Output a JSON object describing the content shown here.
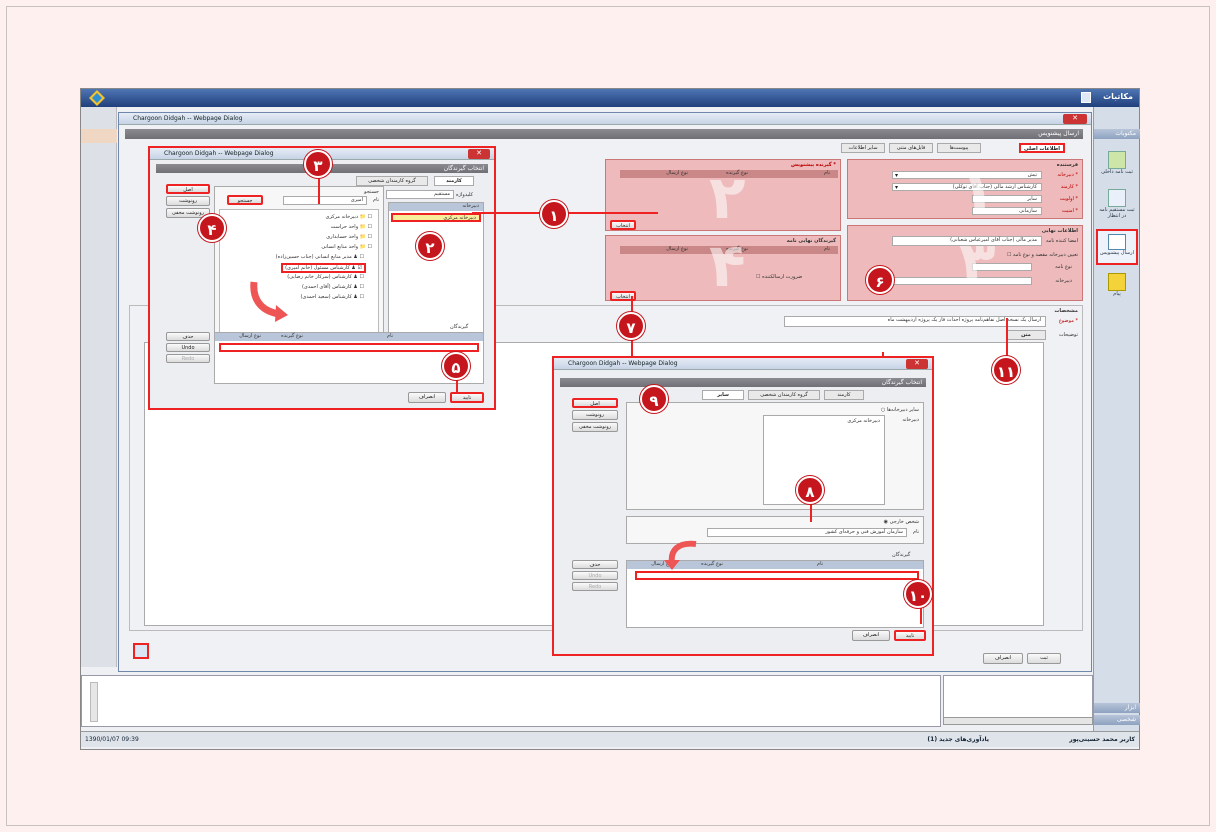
{
  "main_window": {
    "title": "مکاتبات",
    "sidebar_header": "مکتوبات",
    "sidebar_items": [
      {
        "label": "ثبت نامه داخلی",
        "icon": "new-letter-icon"
      },
      {
        "label": "ثبت مستقیم نامه در انتظار",
        "icon": "direct-letter-icon"
      },
      {
        "label": "ارسال پیشنویس",
        "icon": "send-draft-icon"
      },
      {
        "label": "پیام",
        "icon": "message-icon"
      }
    ],
    "sidebar_footer_tools": "ابزار",
    "sidebar_footer_personal": "شخصی",
    "status_user": "کاربر محمد حسینی‌پور",
    "status_reminders": "یادآوری‌های جدید (1)",
    "status_datetime": "1390/01/07 09:39"
  },
  "draft_dialog": {
    "title": "Chargoon Didgah -- Webpage Dialog",
    "header": "ارسال پیشنویس",
    "tabs": [
      "اطلاعات اصلی",
      "پیوست‌ها",
      "فایل‌های متنی",
      "سایر اطلاعات"
    ],
    "sender_group": "فرستنده",
    "secretariat_label": "* دبیرخانه",
    "secretariat_value": "تیش",
    "employee_label": "* کارمند",
    "employee_value": "کارشناس ارشد مالی (جناب آقای توکلی)",
    "priority_label": "* اولویت",
    "priority_value": "سایر",
    "security_label": "* امنیت",
    "security_value": "سازمانی",
    "recipient_group": "* گیرنده پیشنویس",
    "recipient_cols": [
      "نام",
      "نوع گیرنده",
      "نوع ارسال"
    ],
    "final_recipients_group": "گیرندگان نهایی نامه",
    "final_info_group": "اطلاعات نهایی",
    "signer_label": "امضا کننده نامه",
    "signer_value": "مدیر مالی (جناب آقای امیرعباس شعبانی)",
    "dest_check_label": "تعیین دبیرخانه مقصد و نوع نامه",
    "letter_type_label": "نوع نامه",
    "dest_secretariat_label": "دبیرخانه",
    "need_sender_label": "ضرورت ارسالکننده",
    "select_btn_1": "انتخاب",
    "select_btn_2": "انتخاب",
    "specs_group": "مشخصات",
    "subject_label": "* موضوع",
    "subject_value": "ارسال یک نسخه اصل تفاهم‌نامه پروژه احداث فاز یک پروژه اردیبهشت ماه",
    "desc_label": "توضیحات",
    "text_tab": "متن",
    "ok_button": "ثبت",
    "cancel_button": "انصراف"
  },
  "select_dialog_1": {
    "title": "Chargoon Didgah -- Webpage Dialog",
    "header": "انتخاب گیرندگان",
    "tabs": [
      "کارمند",
      "گروه کارمندان شخصی"
    ],
    "org_label": "کلیدواژه",
    "org_value": "مستقیم",
    "search_label": "جستجو",
    "name_label": "نام",
    "name_value": "امیری",
    "search_button": "جستجو",
    "secretariat_list_header": "دبیرخانه",
    "secretariat_item": "دبیرخانه مرکزی",
    "tree_items": [
      "دبیرخانه مرکزی",
      "واحد حراست",
      "واحد حسابداری",
      "واحد منابع انسانی",
      "مدیر منابع انسانی (جناب حسین‌زاده)",
      "کارشناس مسئول (خانم امیری)",
      "کارشناس (سرکار خانم رضایی)",
      "کارشناس (آقای احمدی)",
      "کارشناس (سعید احمدی)"
    ],
    "type_buttons": [
      "اصل",
      "رونوشت",
      "رونوشت مخفی"
    ],
    "receivers_label": "گیرندگان",
    "receivers_cols": [
      "نام",
      "نوع گیرنده",
      "نوع ارسال"
    ],
    "side_buttons": [
      "حذف",
      "Undo",
      "Redo"
    ],
    "ok_button": "تایید",
    "cancel_button": "انصراف"
  },
  "select_dialog_2": {
    "title": "Chargoon Didgah -- Webpage Dialog",
    "header": "انتخاب گیرندگان",
    "tabs": [
      "کارمند",
      "گروه کارمندان شخصی",
      "سایر"
    ],
    "other_secretariats": "سایر دبیرخانه‌ها",
    "secretariat_label": "دبیرخانه",
    "secretariat_item": "دبیرخانه مرکزی",
    "external_person": "شخص خارجی",
    "name_label": "نام",
    "name_value": "سازمان آموزش فنی و حرفه‌ای کشور",
    "type_buttons": [
      "اصل",
      "رونوشت",
      "رونوشت مخفی"
    ],
    "receivers_label": "گیرندگان",
    "receivers_cols": [
      "نام",
      "نوع گیرنده",
      "نوع ارسال"
    ],
    "side_buttons": [
      "حذف",
      "Undo",
      "Redo"
    ],
    "ok_button": "تایید",
    "cancel_button": "انصراف"
  },
  "callouts": [
    "۱",
    "۲",
    "۳",
    "۴",
    "۵",
    "۶",
    "۷",
    "۸",
    "۹",
    "۱۰",
    "۱۱"
  ],
  "watermark_digits": [
    "۱",
    "۲",
    "۳",
    "۴"
  ],
  "colors": {
    "accent_red": "#e22222",
    "callout_red": "#c4161c",
    "title_blue": "#2a4f8f"
  }
}
